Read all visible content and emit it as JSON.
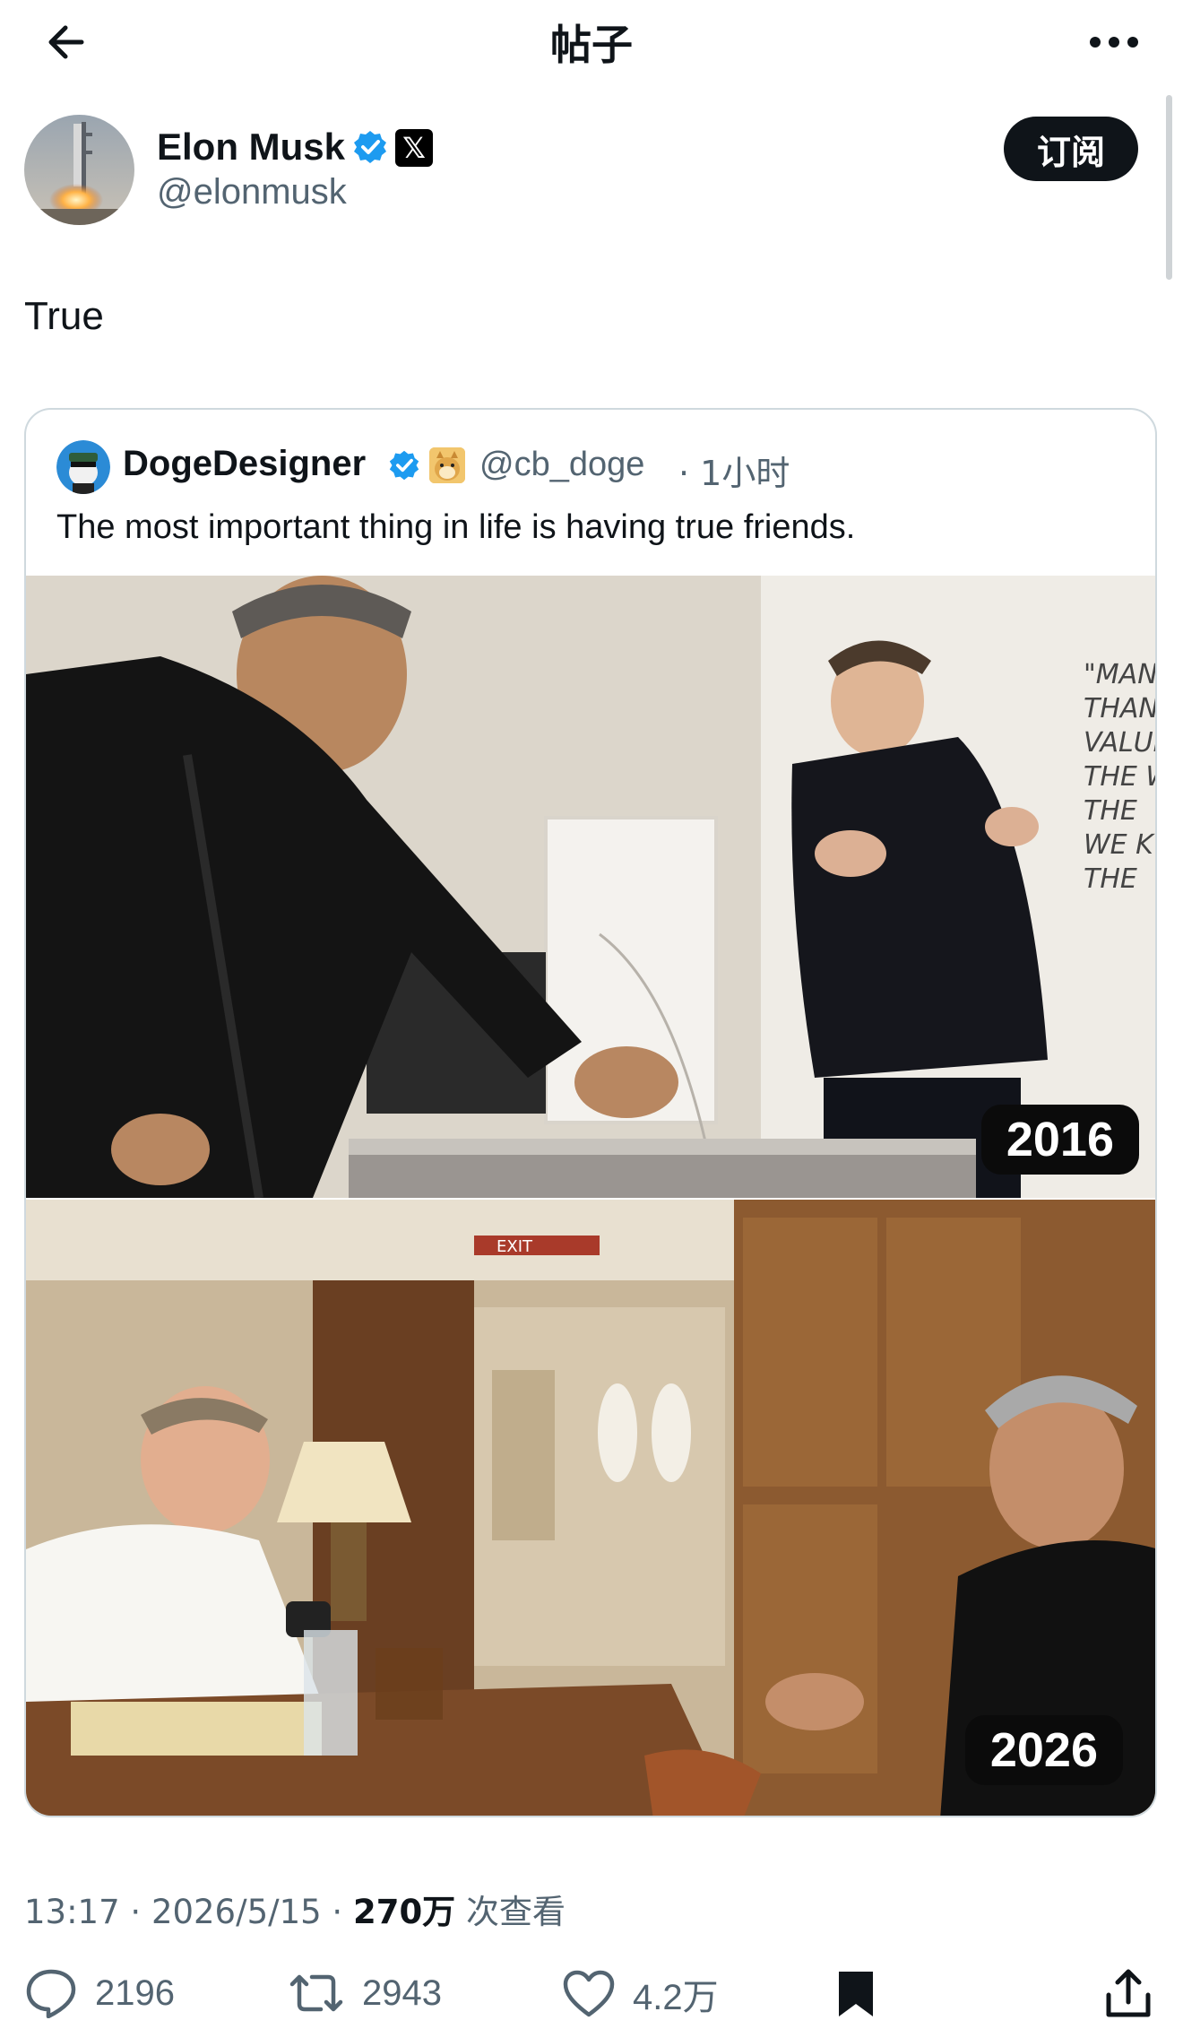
{
  "header": {
    "title": "帖子"
  },
  "author": {
    "name": "Elon Musk",
    "handle": "@elonmusk",
    "badge_letter": "𝕏",
    "subscribe_label": "订阅"
  },
  "post": {
    "text": "True"
  },
  "quote": {
    "name": "DogeDesigner",
    "handle": "@cb_doge",
    "time": "· 1小时",
    "text": "The most important thing in life is having true friends.",
    "photo_top": {
      "year": "2016",
      "wall_text": [
        "\"MAN H",
        "THAN",
        "VALUE",
        "THE W",
        "THE",
        "WE K",
        "THE"
      ]
    },
    "photo_bottom": {
      "year": "2026",
      "exit_sign": "EXIT"
    }
  },
  "meta": {
    "time": "13:17",
    "date": "2026/5/15",
    "views": "270万",
    "views_label": "次查看",
    "separator": "·"
  },
  "actions": {
    "replies": "2196",
    "reposts": "2943",
    "likes": "4.2万"
  },
  "colors": {
    "accent": "#1d9bf0",
    "text": "#0f1419",
    "muted": "#536471",
    "border": "#cfd9de"
  }
}
